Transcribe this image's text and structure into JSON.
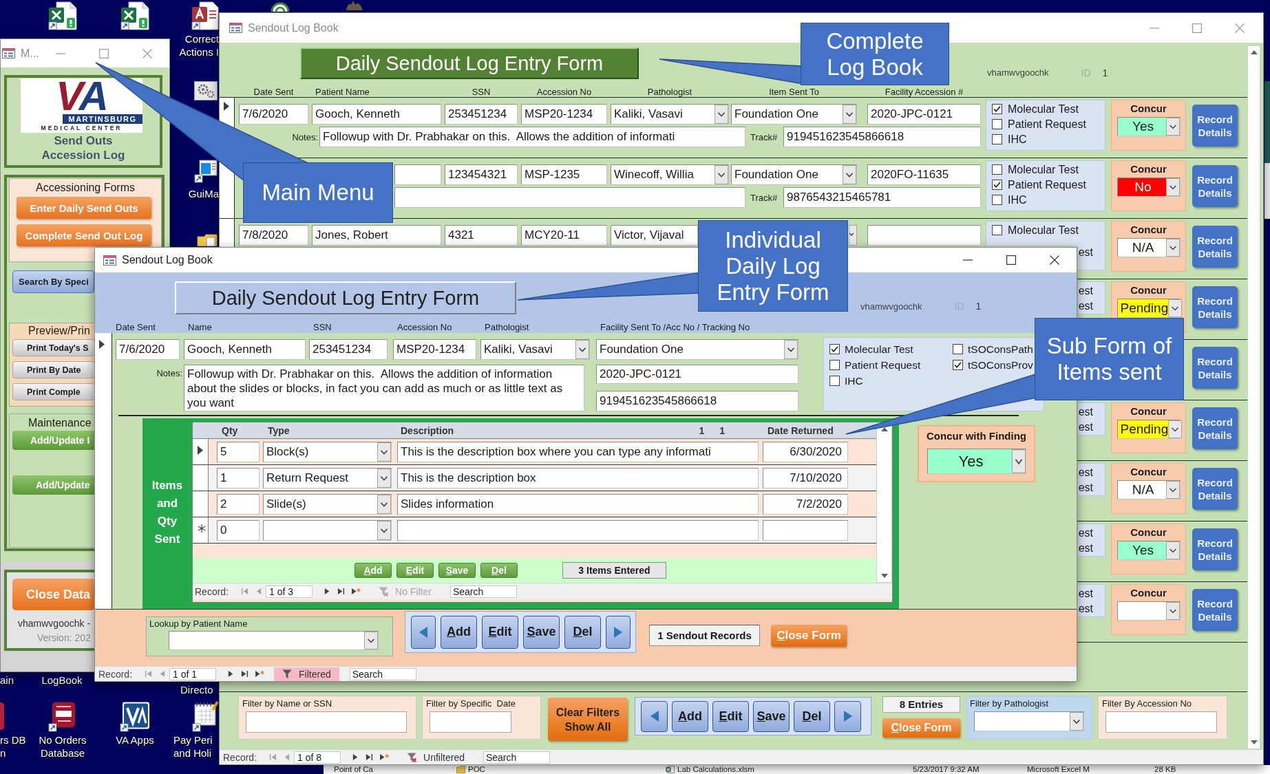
{
  "desktop": {
    "icons": [
      {
        "kind": "sheet"
      },
      {
        "kind": "sheet"
      },
      {
        "kind": "database",
        "label": "Correct Actions I"
      },
      {
        "kind": "disc"
      },
      {
        "kind": "creature"
      },
      {
        "kind": "gear"
      },
      {
        "kind": "monitor",
        "label": "GuiMa"
      },
      {
        "kind": "folder"
      },
      {
        "kind": "none",
        "label": "ain"
      },
      {
        "kind": "none",
        "label": "LogBook"
      },
      {
        "kind": "none",
        "label": "Directo"
      },
      {
        "kind": "rededge",
        "label": "rs DB n"
      },
      {
        "kind": "badge",
        "label": "No Orders Database"
      },
      {
        "kind": "va",
        "label": "VA Apps"
      },
      {
        "kind": "calendar",
        "label": "Pay Peri and Holi"
      }
    ]
  },
  "main_menu": {
    "title": "M...",
    "logo": {
      "letters": "VA",
      "name": "MARTINSBURG",
      "subtitle": "MEDICAL CENTER"
    },
    "app_title": [
      "Send Outs",
      "Accession Log"
    ],
    "sections": [
      {
        "kind": "forms",
        "heading": "Accessioning Forms",
        "buttons": [
          "Enter Daily Send Outs",
          "Complete Send Out Log"
        ]
      },
      {
        "kind": "search",
        "buttons": [
          "Search By Speci"
        ]
      },
      {
        "kind": "print",
        "heading": "Preview/Prin",
        "buttons": [
          "Print Today's S",
          "Print By Date",
          "Print Comple"
        ]
      },
      {
        "kind": "maintenance",
        "heading": "Maintenance",
        "buttons": [
          "Add/Update I",
          "Add/Update"
        ]
      }
    ],
    "close_button": "Close Data",
    "user": "vhamwvgoochk -",
    "version": "Version: 202"
  },
  "log_book": {
    "title": "Sendout Log Book",
    "heading": "Daily Sendout Log Entry Form",
    "user": "vhamwvgoochk",
    "id_label": "ID",
    "id_value": "1",
    "columns": [
      "Date Sent",
      "Patient Name",
      "SSN",
      "Accession No",
      "Pathologist",
      "Item Sent To",
      "Facility Accession #"
    ],
    "records": [
      {
        "kind": "full",
        "selected": true,
        "date_sent": "7/6/2020",
        "patient_name": "Gooch, Kenneth",
        "ssn": "253451234",
        "accession_no": "MSP20-1234",
        "pathologist": "Kaliki, Vasavi",
        "item_sent_to": "Foundation One",
        "facility_accession": "2020-JPC-0121",
        "notes_label": "Notes:",
        "notes": "Followup with Dr. Prabhakar on this.  Allows the addition of informati",
        "track_label": "Track#",
        "track": "919451623545866618",
        "checks": [
          {
            "kind": "full",
            "label": "Molecular Test",
            "checked": true
          },
          {
            "kind": "full",
            "label": "Patient Request",
            "checked": false
          },
          {
            "kind": "full",
            "label": "IHC",
            "checked": false
          }
        ],
        "concur": {
          "label": "Concur",
          "value": "Yes",
          "color": "#99ffcc"
        },
        "details_button": "Record Details"
      },
      {
        "kind": "partial",
        "selected": false,
        "ssn": "123454321",
        "accession_no": "MSP-1235",
        "pathologist": "Winecoff, Willia",
        "item_sent_to": "Foundation One",
        "facility_accession": "2020FO-11635",
        "track_label": "Track#",
        "track": "9876543215465781",
        "checks": [
          {
            "kind": "full",
            "label": "Molecular Test",
            "checked": false
          },
          {
            "kind": "full",
            "label": "Patient Request",
            "checked": true
          },
          {
            "kind": "full",
            "label": "IHC",
            "checked": false
          }
        ],
        "concur": {
          "label": "Concur",
          "value": "No",
          "color": "#ff0000"
        },
        "details_button": "Record Details"
      },
      {
        "kind": "top",
        "selected": false,
        "date_sent": "7/8/2020",
        "patient_name": "Jones, Robert",
        "ssn": "4321",
        "accession_no": "MCY20-11",
        "pathologist": "Victor, Vijaval",
        "checks": [
          {
            "kind": "full",
            "label": "Molecular Test",
            "checked": false
          },
          {
            "kind": "tail",
            "label": "est"
          }
        ],
        "concur": {
          "label": "Concur",
          "value": "N/A"
        },
        "details_button": "Record Details"
      },
      {
        "kind": "edge",
        "checks": [
          {
            "kind": "tail",
            "label": "est"
          },
          {
            "kind": "tail",
            "label": "est"
          }
        ],
        "concur": {
          "label": "Concur",
          "value": "Pending",
          "color": "#ffff00"
        },
        "details_button": "Record Details"
      },
      {
        "kind": "edge",
        "details_button": "Record Details"
      },
      {
        "kind": "edge",
        "checks": [
          {
            "kind": "tail",
            "label": "est"
          },
          {
            "kind": "tail",
            "label": "est"
          }
        ],
        "concur": {
          "label": "Concur",
          "value": "Pending",
          "color": "#ffff00"
        },
        "details_button": "Record Details"
      },
      {
        "kind": "edge",
        "checks": [
          {
            "kind": "tail",
            "label": "est"
          },
          {
            "kind": "tail",
            "label": "est"
          }
        ],
        "concur": {
          "label": "Concur",
          "value": "N/A"
        },
        "details_button": "Record Details"
      },
      {
        "kind": "edge",
        "checks": [
          {
            "kind": "tail",
            "label": "est"
          },
          {
            "kind": "tail",
            "label": "est"
          }
        ],
        "concur": {
          "label": "Concur",
          "value": "Yes",
          "color": "#99ffcc"
        },
        "details_button": "Record Details"
      },
      {
        "kind": "edge",
        "checks": [
          {
            "kind": "tail",
            "label": "est"
          },
          {
            "kind": "tail",
            "label": "est"
          }
        ],
        "concur": {
          "label": "Concur"
        },
        "details_button": "Record Details"
      }
    ],
    "filters": {
      "name_filter": {
        "label": "Filter by Name or SSN"
      },
      "date_filter": {
        "label": "Filter by Specific  Date"
      },
      "clear_button": "Clear Filters Show All",
      "nav_buttons": [
        "Add",
        "Edit",
        "Save",
        "Del"
      ],
      "entries": "8 Entries",
      "close_button": "Close Form",
      "pathologist_filter": {
        "label": "Filter by Pathologist"
      },
      "accession_filter": {
        "label": "Filter By Accession No"
      }
    },
    "nav": {
      "label": "Record:",
      "position": "1 of 8",
      "filter": {
        "label": "Unfiltered",
        "active": false,
        "disabled": false
      },
      "search": {
        "placeholder": "Search"
      }
    }
  },
  "entry_form": {
    "title": "Sendout Log Book",
    "heading": "Daily Sendout Log Entry Form",
    "user": "vhamwvgoochk",
    "id_label": "ID",
    "id_value": "1",
    "columns": [
      "Date Sent",
      "Name",
      "SSN",
      "Accession No",
      "Pathologist",
      "Facility Sent To /Acc No / Tracking No"
    ],
    "record": {
      "selected": true,
      "date_sent": "7/6/2020",
      "name": "Gooch, Kenneth",
      "ssn": "253451234",
      "accession_no": "MSP20-1234",
      "pathologist": "Kaliki, Vasavi",
      "facility": "Foundation One",
      "notes_label": "Notes:",
      "notes": "Followup with Dr. Prabhakar on this.  Allows the addition of information about the slides or blocks, in fact you can add as much or as little text as you want",
      "facility_accession": "2020-JPC-0121",
      "tracking": "919451623545866618"
    },
    "checks": [
      {
        "label": "Molecular Test",
        "checked": true
      },
      {
        "label": "Patient Request",
        "checked": false
      },
      {
        "label": "IHC",
        "checked": false
      },
      {
        "label": "tSOConsPath",
        "checked": false
      },
      {
        "label": "tSOConsProv",
        "checked": true
      }
    ],
    "items": {
      "side_label": "Items and Qty Sent",
      "columns": [
        "Qty",
        "Type",
        "Description",
        "1",
        "1",
        "Date Returned"
      ],
      "rows": [
        {
          "kind": "record",
          "selected": true,
          "qty": "5",
          "type": "Block(s)",
          "description": "This is the description box where you can type any informati",
          "date_returned": "6/30/2020"
        },
        {
          "kind": "record",
          "selected": false,
          "qty": "1",
          "type": "Return Request",
          "description": "This is the description box",
          "date_returned": "7/10/2020"
        },
        {
          "kind": "record",
          "selected": false,
          "qty": "2",
          "type": "Slide(s)",
          "description": "Slides information",
          "date_returned": "7/2/2020"
        },
        {
          "kind": "new",
          "selected": false,
          "qty": "0"
        }
      ],
      "buttons": [
        "Add",
        "Edit",
        "Save",
        "Del"
      ],
      "count": "3 Items Entered",
      "nav": {
        "label": "Record:",
        "position": "1 of 3",
        "filter": {
          "label": "No Filter",
          "active": false,
          "disabled": true
        },
        "search": {
          "placeholder": "Search"
        }
      }
    },
    "concur": {
      "label": "Concur with Finding",
      "value": "Yes",
      "color": "#99ffcc"
    },
    "lookup": {
      "label": "Lookup by Patient Name"
    },
    "nav_buttons": [
      "Add",
      "Edit",
      "Save",
      "Del"
    ],
    "record_count": "1 Sendout Records",
    "close_button": "Close Form",
    "nav": {
      "label": "Record:",
      "position": "1 of 1",
      "filter": {
        "label": "Filtered",
        "active": true,
        "disabled": false
      },
      "search": {
        "placeholder": "Search"
      }
    }
  },
  "callouts": [
    {
      "text": "Complete Log Book"
    },
    {
      "text": "Main Menu"
    },
    {
      "text": "Individual Daily Log Entry Form"
    },
    {
      "text": "Sub Form of Items sent"
    }
  ],
  "file_browser": {
    "items": [
      {
        "kind": "tree",
        "text": "Point of Ca"
      },
      {
        "kind": "folder",
        "text": "POC"
      },
      {
        "kind": "file",
        "text": "Lab Calculations.xlsm"
      },
      {
        "kind": "cell",
        "text": "5/23/2017 9:32 AM"
      },
      {
        "kind": "cell",
        "text": "Microsoft Excel M"
      },
      {
        "kind": "cell",
        "text": "28 KB"
      }
    ]
  }
}
